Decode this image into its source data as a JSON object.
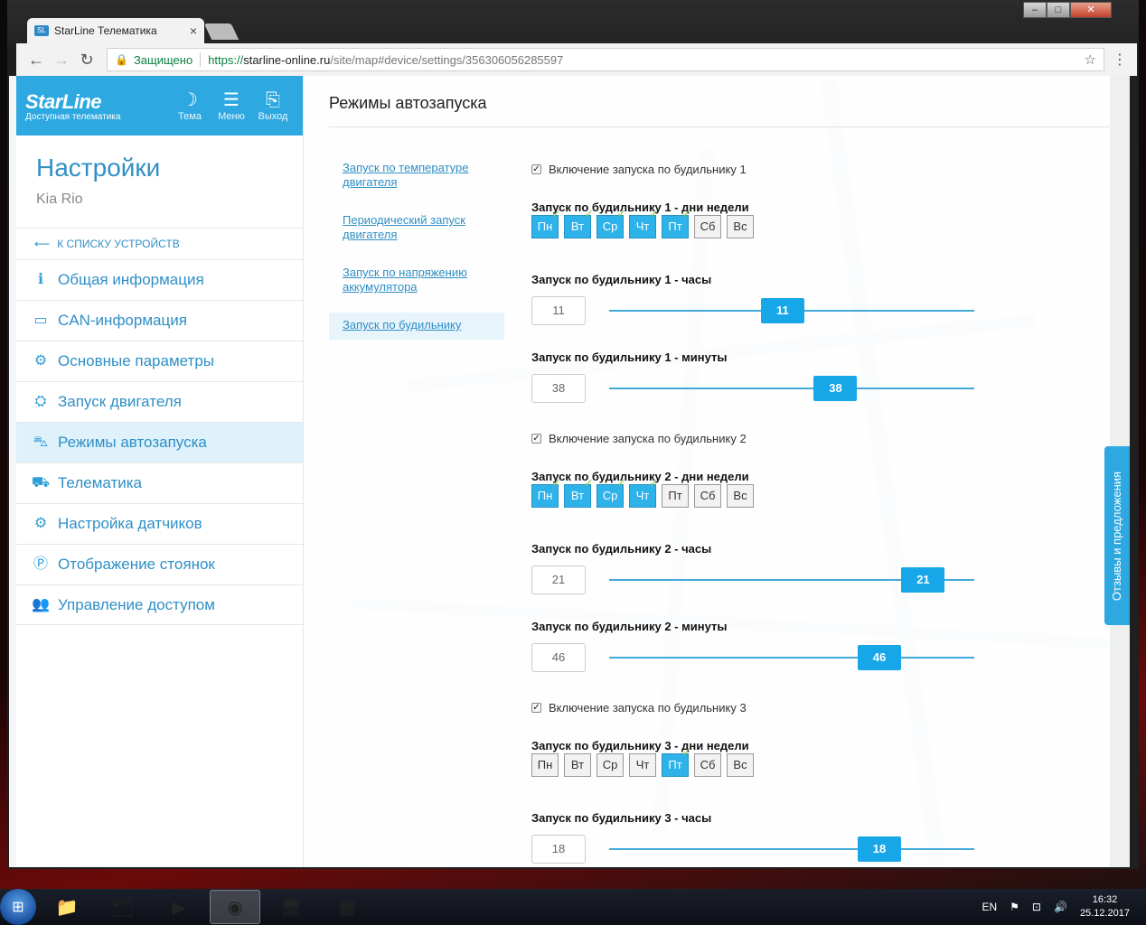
{
  "browser": {
    "tab_title": "StarLine Телематика",
    "tab_close": "×",
    "secure_label": "Защищено",
    "url_proto": "https://",
    "url_host": "starline-online.ru",
    "url_path": "/site/map#device/settings/356306056285597",
    "window_controls": [
      "–",
      "□",
      "✕"
    ]
  },
  "header": {
    "brand_name": "StarLine",
    "brand_sub": "Доступная телематика",
    "buttons": [
      {
        "label": "Тема",
        "icon": "moon-icon",
        "glyph": "☽"
      },
      {
        "label": "Меню",
        "icon": "hamburger-icon",
        "glyph": "☰"
      },
      {
        "label": "Выход",
        "icon": "exit-icon",
        "glyph": "⎘"
      }
    ]
  },
  "sidebar": {
    "title": "Настройки",
    "subtitle": "Kia Rio",
    "back_label": "К СПИСКУ УСТРОЙСТВ",
    "back_glyph": "⟵",
    "items": [
      {
        "label": "Общая информация",
        "icon": "info-icon",
        "glyph": "ℹ"
      },
      {
        "label": "CAN-информация",
        "icon": "can-icon",
        "glyph": "▭"
      },
      {
        "label": "Основные параметры",
        "icon": "gear-icon",
        "glyph": "⚙"
      },
      {
        "label": "Запуск двигателя",
        "icon": "engine-icon",
        "glyph": "⛭"
      },
      {
        "label": "Режимы автозапуска",
        "icon": "autostart-icon",
        "glyph": "⛍"
      },
      {
        "label": "Телематика",
        "icon": "telematics-icon",
        "glyph": "⛟"
      },
      {
        "label": "Настройка датчиков",
        "icon": "sensors-icon",
        "glyph": "⚙"
      },
      {
        "label": "Отображение стоянок",
        "icon": "parking-icon",
        "glyph": "Ⓟ"
      },
      {
        "label": "Управление доступом",
        "icon": "users-icon",
        "glyph": "👥"
      }
    ],
    "active_index": 4
  },
  "content": {
    "title": "Режимы автозапуска",
    "subnav": [
      {
        "label": "Запуск по температуре двигателя"
      },
      {
        "label": "Периодический запуск двигателя"
      },
      {
        "label": "Запуск по напряжению аккумулятора"
      },
      {
        "label": "Запуск по будильнику"
      }
    ],
    "day_labels": [
      "Пн",
      "Вт",
      "Ср",
      "Чт",
      "Пт",
      "Сб",
      "Вс"
    ],
    "alarms": [
      {
        "enable_label": "Включение запуска по будильнику 1",
        "enabled": true,
        "days_label": "Запуск по будильнику 1 - дни недели",
        "days_on": [
          true,
          true,
          true,
          true,
          true,
          false,
          false
        ],
        "hours_label": "Запуск по будильнику 1 - часы",
        "hours": "11",
        "hours_fraction": 0.475,
        "minutes_label": "Запуск по будильнику 1 - минуты",
        "minutes": "38",
        "minutes_fraction": 0.62
      },
      {
        "enable_label": "Включение запуска по будильнику 2",
        "enabled": true,
        "days_label": "Запуск по будильнику 2 - дни недели",
        "days_on": [
          true,
          true,
          true,
          true,
          false,
          false,
          false
        ],
        "hours_label": "Запуск по будильнику 2 - часы",
        "hours": "21",
        "hours_fraction": 0.86,
        "minutes_label": "Запуск по будильнику 2 - минуты",
        "minutes": "46",
        "minutes_fraction": 0.74
      },
      {
        "enable_label": "Включение запуска по будильнику 3",
        "enabled": true,
        "days_label": "Запуск по будильнику 3 - дни недели",
        "days_on": [
          false,
          false,
          false,
          false,
          true,
          false,
          false
        ],
        "hours_label": "Запуск по будильнику 3 - часы",
        "hours": "18",
        "hours_fraction": 0.74
      }
    ],
    "feedback_label": "Отзывы и предложения"
  },
  "taskbar": {
    "lang": "EN",
    "time": "16:32",
    "date": "25.12.2017"
  },
  "colors": {
    "brand": "#2ea8e0",
    "accent": "#17a6e8",
    "link": "#2f8fc6",
    "check": "#8bc34a"
  }
}
